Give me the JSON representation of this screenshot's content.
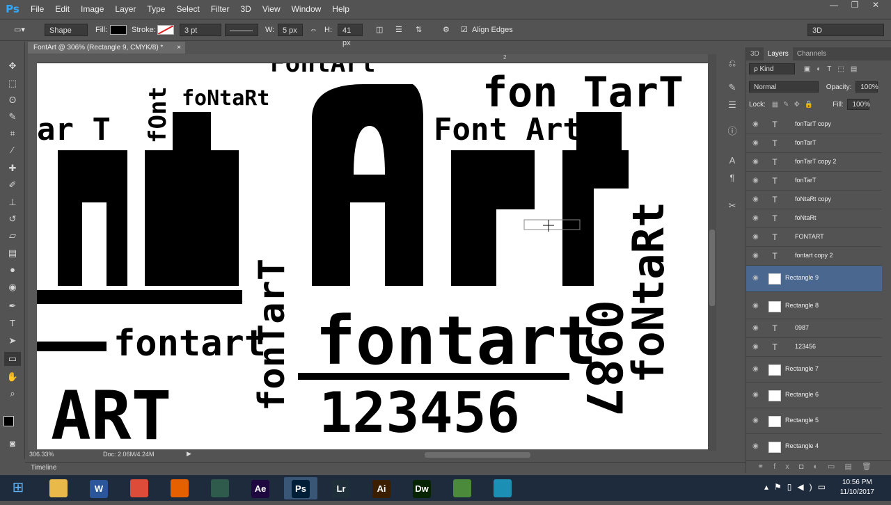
{
  "app": {
    "logo": "Ps"
  },
  "menu": [
    "File",
    "Edit",
    "Image",
    "Layer",
    "Type",
    "Select",
    "Filter",
    "3D",
    "View",
    "Window",
    "Help"
  ],
  "window_controls": [
    "—",
    "❐",
    "✕"
  ],
  "options": {
    "tool_mode": "Shape",
    "fill_label": "Fill:",
    "stroke_label": "Stroke:",
    "stroke_size": "3 pt",
    "w_label": "W:",
    "w_value": "5 px",
    "h_label": "H:",
    "h_value": "41 px",
    "align_edges": "Align Edges",
    "workspace": "3D",
    "fill_color": "#000000"
  },
  "document": {
    "tab_title": "FontArt @ 306% (Rectangle 9, CMYK/8) *",
    "close": "×",
    "ruler_mark": "2"
  },
  "canvas_text": {
    "fontart_top": "FontArt",
    "fontar_t": "fon TarT",
    "fontaRt": "foNtaRt",
    "font_art": "Font Art",
    "big_art": "ntArt",
    "fontart_mid": "fontart",
    "fontart_left": "fontart",
    "art_bottom": "ART",
    "numbers": "123456",
    "num_vertical": "0987",
    "ar_t": "ar T",
    "fonTarT_vert": "fonTarT",
    "foNtaRt_vert": "foNtaRt",
    "font_vert": "fOnt"
  },
  "status": {
    "zoom": "306.33%",
    "doc_size": "Doc: 2.06M/4.24M"
  },
  "timeline_label": "Timeline",
  "panel": {
    "tabs": [
      "3D",
      "Layers",
      "Channels"
    ],
    "active_tab": "Layers",
    "filter_kind": "ρ Kind",
    "blend_mode": "Normal",
    "opacity_label": "Opacity:",
    "opacity_value": "100%",
    "lock_label": "Lock:",
    "fill_label": "Fill:",
    "fill_value": "100%",
    "layers": [
      {
        "name": "fonTarT copy",
        "type": "text"
      },
      {
        "name": "fonTarT",
        "type": "text"
      },
      {
        "name": "fonTarT copy 2",
        "type": "text"
      },
      {
        "name": "fonTarT",
        "type": "text"
      },
      {
        "name": "foNtaRt copy",
        "type": "text"
      },
      {
        "name": "foNtaRt",
        "type": "text"
      },
      {
        "name": "FONTART",
        "type": "text"
      },
      {
        "name": "fontart copy 2",
        "type": "text"
      },
      {
        "name": "Rectangle 9",
        "type": "shape",
        "selected": true
      },
      {
        "name": "Rectangle 8",
        "type": "shape"
      },
      {
        "name": "0987",
        "type": "text"
      },
      {
        "name": "123456",
        "type": "text"
      },
      {
        "name": "Rectangle 7",
        "type": "shape"
      },
      {
        "name": "Rectangle 6",
        "type": "shape"
      },
      {
        "name": "Rectangle 5",
        "type": "shape"
      },
      {
        "name": "Rectangle 4",
        "type": "shape"
      }
    ]
  },
  "taskbar": {
    "apps": [
      {
        "label": "",
        "name": "explorer",
        "color": "#e9b949"
      },
      {
        "label": "W",
        "name": "word",
        "color": "#2b579a"
      },
      {
        "label": "",
        "name": "chrome",
        "color": "#dd4b39"
      },
      {
        "label": "",
        "name": "firefox",
        "color": "#e66000"
      },
      {
        "label": "",
        "name": "app5",
        "color": "#2f5b4d"
      },
      {
        "label": "Ae",
        "name": "after-effects",
        "color": "#1f0740"
      },
      {
        "label": "Ps",
        "name": "photoshop",
        "color": "#001e36"
      },
      {
        "label": "Lr",
        "name": "lightroom",
        "color": "#1f2f3a"
      },
      {
        "label": "Ai",
        "name": "illustrator",
        "color": "#3b1e00"
      },
      {
        "label": "Dw",
        "name": "dreamweaver",
        "color": "#072401"
      },
      {
        "label": "",
        "name": "app11",
        "color": "#4a8a3a"
      },
      {
        "label": "",
        "name": "app12",
        "color": "#1b8fb4"
      }
    ],
    "time": "10:56 PM",
    "date": "11/10/2017"
  }
}
